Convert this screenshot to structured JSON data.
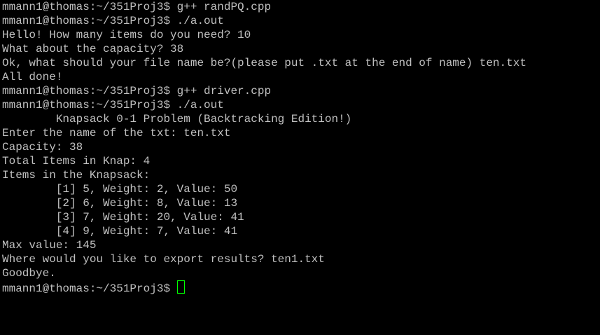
{
  "terminal": {
    "lines": [
      "mmann1@thomas:~/351Proj3$ g++ randPQ.cpp",
      "mmann1@thomas:~/351Proj3$ ./a.out",
      "Hello! How many items do you need? 10",
      "What about the capacity? 38",
      "Ok, what should your file name be?(please put .txt at the end of name) ten.txt",
      "All done!",
      "mmann1@thomas:~/351Proj3$ g++ driver.cpp",
      "mmann1@thomas:~/351Proj3$ ./a.out",
      "        Knapsack 0-1 Problem (Backtracking Edition!)",
      "Enter the name of the txt: ten.txt",
      "Capacity: 38",
      "Total Items in Knap: 4",
      "Items in the Knapsack:",
      "        [1] 5, Weight: 2, Value: 50",
      "        [2] 6, Weight: 8, Value: 13",
      "        [3] 7, Weight: 20, Value: 41",
      "        [4] 9, Weight: 7, Value: 41",
      "Max value: 145",
      "Where would you like to export results? ten1.txt",
      "Goodbye."
    ],
    "prompt": "mmann1@thomas:~/351Proj3$ ",
    "cursor_color": "#00ff00",
    "text_color": "#c0c0c0",
    "background_color": "#000000"
  }
}
